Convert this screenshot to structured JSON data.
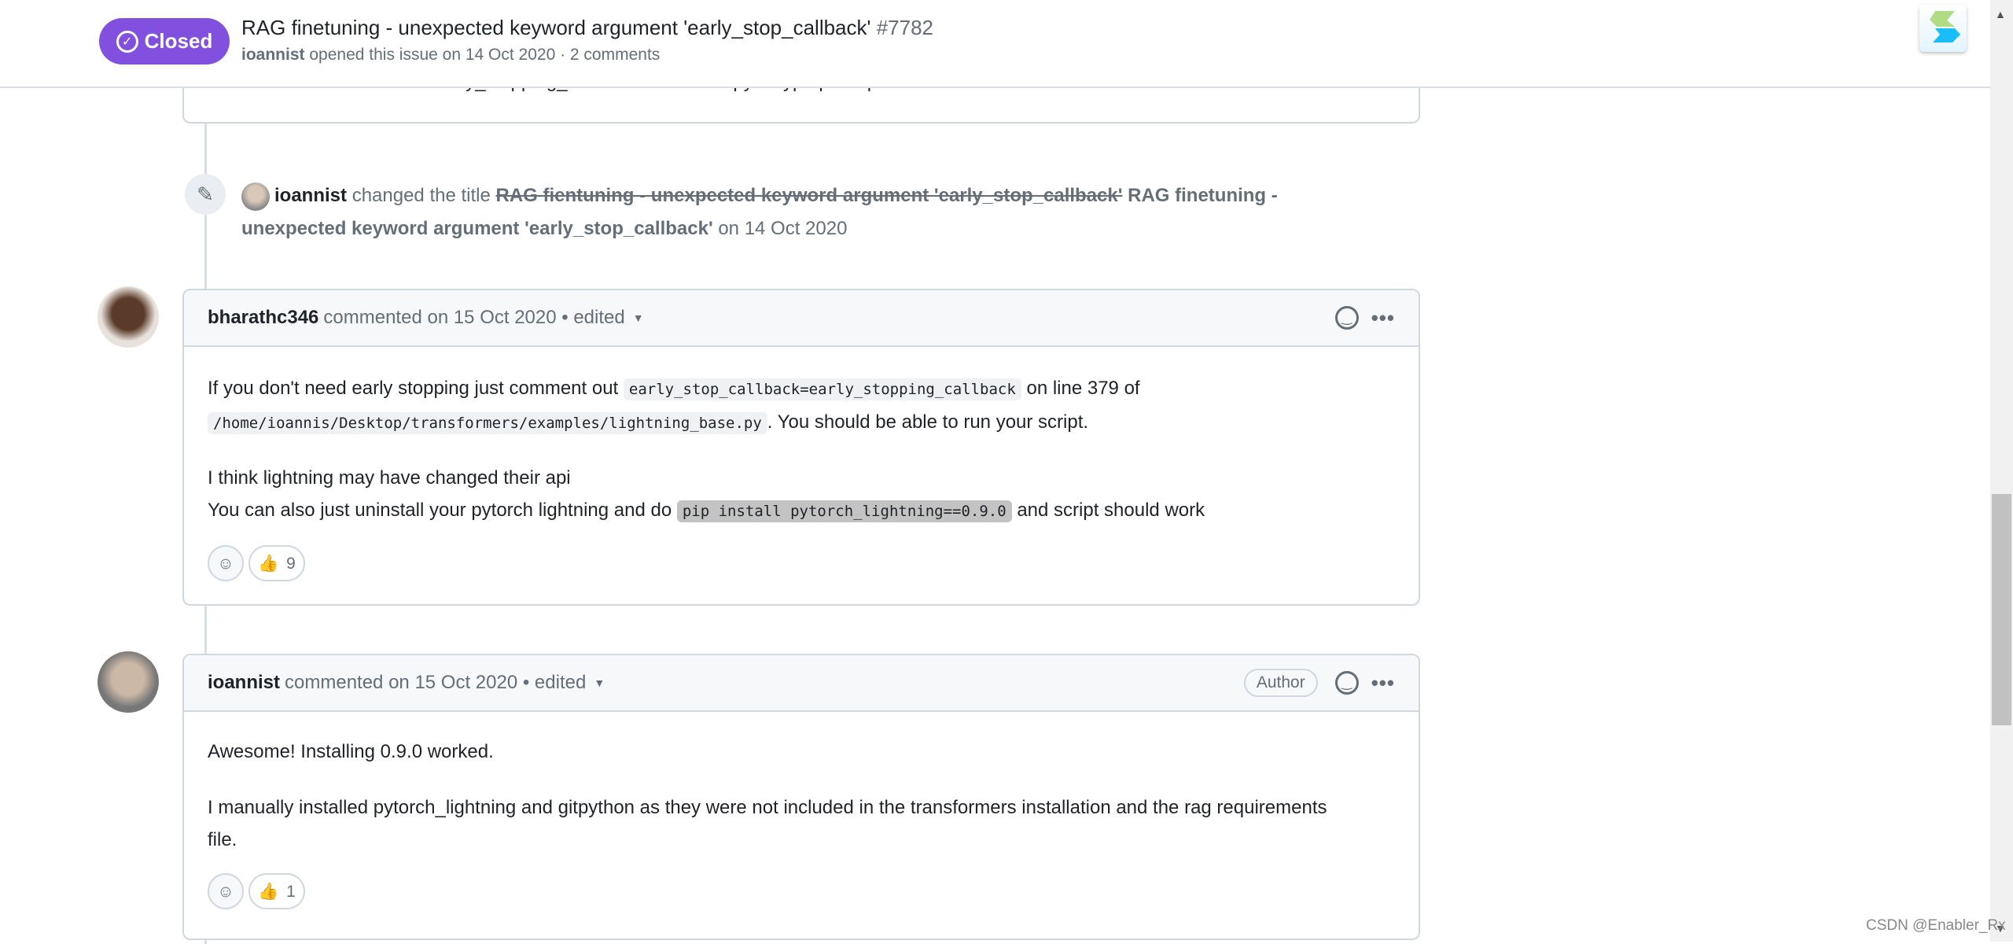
{
  "header": {
    "status": "Closed",
    "title": "RAG finetuning - unexpected keyword argument 'early_stop_callback'",
    "number": "#7782",
    "author": "ioannist",
    "meta": "opened this issue on 14 Oct 2020 · 2 comments"
  },
  "previous_comment_tail": "I noticed a variable named early_stopping_callback in finetune.py. A typo perhaps?",
  "event": {
    "actor": "ioannist",
    "action": "changed the title",
    "old_title": "RAG fientuning - unexpected keyword argument 'early_stop_callback'",
    "new_title": "RAG finetuning - unexpected keyword argument 'early_stop_callback'",
    "date": "on 14 Oct 2020"
  },
  "comments": [
    {
      "author": "bharathc346",
      "meta": "commented on 15 Oct 2020 • edited",
      "p1a": "If you don't need early stopping just comment out",
      "code1": "early_stop_callback=early_stopping_callback",
      "p1b": "on line 379 of",
      "code2": "/home/ioannis/Desktop/transformers/examples/lightning_base.py",
      "p1c": ". You should be able to run your script.",
      "p2a": "I think lightning may have changed their api",
      "p2b": "You can also just uninstall your pytorch lightning and do",
      "code3": "pip install pytorch_lightning==0.9.0",
      "p2c": "and script should work",
      "thumbs": "9"
    },
    {
      "author": "ioannist",
      "meta": "commented on 15 Oct 2020 • edited",
      "badge": "Author",
      "p1": "Awesome! Installing 0.9.0 worked.",
      "p2": "I manually installed pytorch_lightning and gitpython as they were not included in the transformers installation and the rag requirements file.",
      "thumbs": "1"
    }
  ],
  "watermark": "CSDN @Enabler_Rx",
  "colors": {
    "closed": "#8250df",
    "selection": "#c3c3c3"
  }
}
